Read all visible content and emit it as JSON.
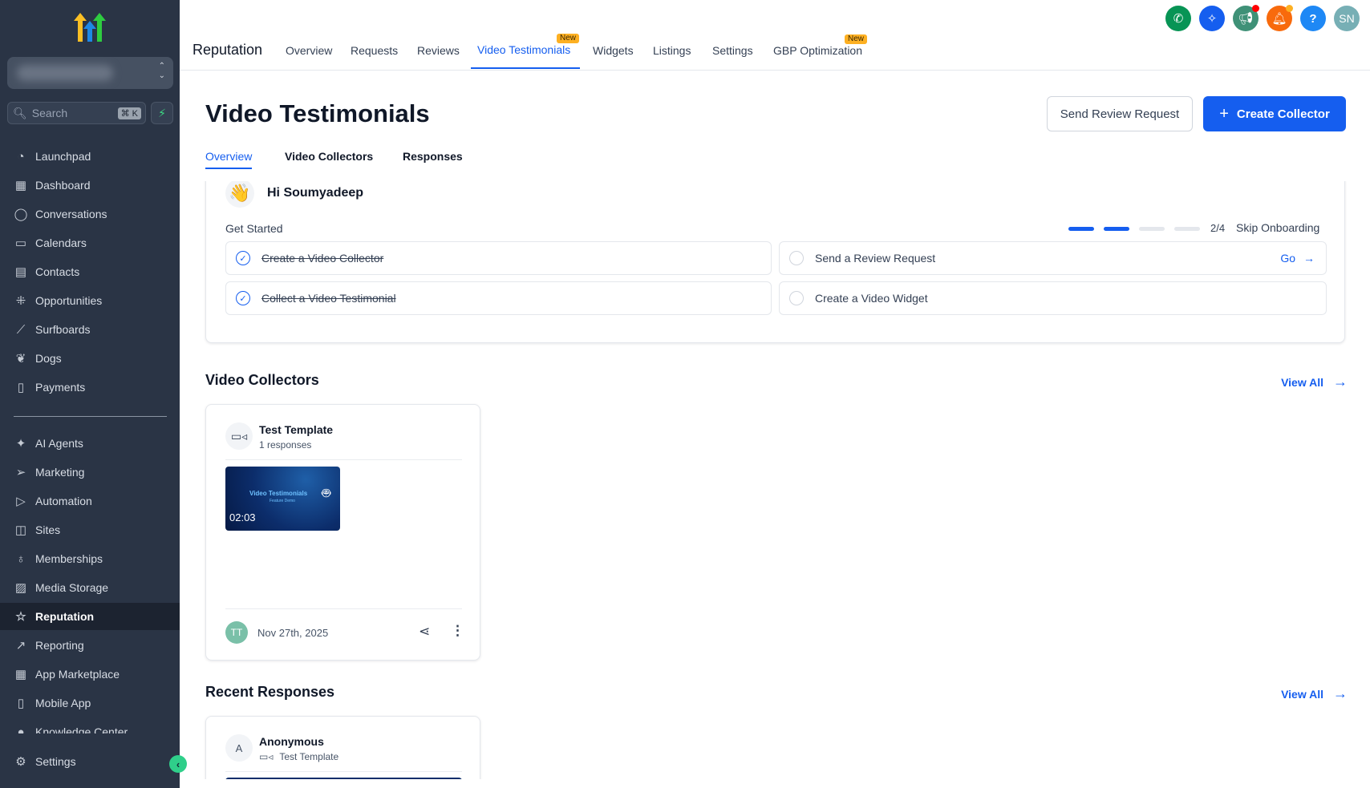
{
  "sidebar": {
    "search_placeholder": "Search",
    "shortcut": "⌘ K",
    "items": [
      {
        "label": "Launchpad",
        "icon": "launchpad-icon"
      },
      {
        "label": "Dashboard",
        "icon": "dashboard-icon"
      },
      {
        "label": "Conversations",
        "icon": "chat-icon"
      },
      {
        "label": "Calendars",
        "icon": "calendar-icon"
      },
      {
        "label": "Contacts",
        "icon": "contacts-icon"
      },
      {
        "label": "Opportunities",
        "icon": "opportunities-icon"
      },
      {
        "label": "Surfboards",
        "icon": "surfboard-icon"
      },
      {
        "label": "Dogs",
        "icon": "dog-icon"
      },
      {
        "label": "Payments",
        "icon": "payments-icon"
      }
    ],
    "items2": [
      {
        "label": "AI Agents"
      },
      {
        "label": "Marketing"
      },
      {
        "label": "Automation"
      },
      {
        "label": "Sites"
      },
      {
        "label": "Memberships"
      },
      {
        "label": "Media Storage"
      },
      {
        "label": "Reputation"
      },
      {
        "label": "Reporting"
      },
      {
        "label": "App Marketplace"
      },
      {
        "label": "Mobile App"
      },
      {
        "label": "Knowledge Center"
      }
    ],
    "settings": "Settings"
  },
  "topnav": {
    "title": "Reputation",
    "tabs": [
      "Overview",
      "Requests",
      "Reviews",
      "Video Testimonials",
      "Widgets",
      "Listings",
      "Settings",
      "GBP Optimization"
    ],
    "new_badge": "New",
    "avatar": "SN",
    "help": "?"
  },
  "page": {
    "title": "Video Testimonials",
    "send_review_request": "Send Review Request",
    "create_collector": "Create Collector",
    "subtabs": [
      "Overview",
      "Video Collectors",
      "Responses"
    ]
  },
  "onboarding": {
    "greeting": "Hi Soumyadeep",
    "get_started": "Get Started",
    "progress_text": "2/4",
    "progress": 0.5,
    "skip": "Skip Onboarding",
    "tasks": [
      {
        "label": "Create a Video Collector",
        "done": true
      },
      {
        "label": "Send a Review Request",
        "done": false,
        "action": "Go"
      },
      {
        "label": "Collect a Video Testimonial",
        "done": true
      },
      {
        "label": "Create a Video Widget",
        "done": false
      }
    ]
  },
  "collectors": {
    "heading": "Video Collectors",
    "view_all": "View All",
    "card": {
      "name": "Test Template",
      "responses": "1 responses",
      "duration": "02:03",
      "video_title": "Video Testimonials",
      "video_subtitle": "Feature Demo",
      "avatar": "TT",
      "date": "Nov 27th, 2025"
    }
  },
  "recent": {
    "heading": "Recent Responses",
    "view_all": "View All",
    "card": {
      "avatar": "A",
      "name": "Anonymous",
      "template": "Test Template"
    }
  },
  "colors": {
    "accent": "#155eef",
    "sidebar": "#2a3445"
  }
}
